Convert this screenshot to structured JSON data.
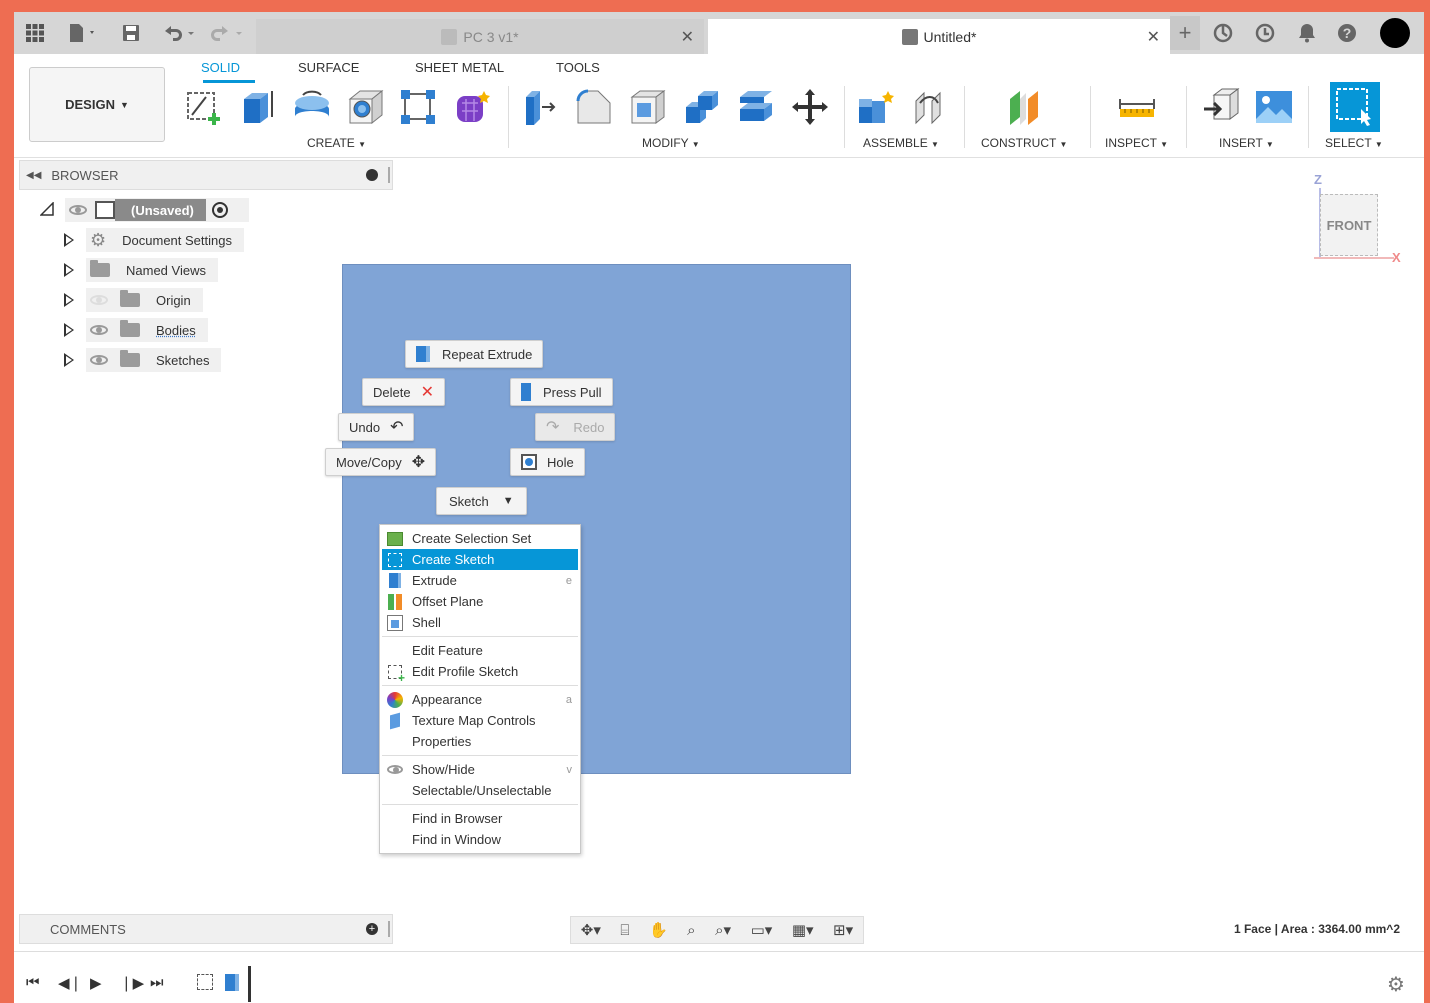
{
  "tabs": {
    "inactive_doc": "PC 3 v1*",
    "active_doc": "Untitled*"
  },
  "toolbar": {
    "design_label": "DESIGN",
    "tabs": [
      "SOLID",
      "SURFACE",
      "SHEET METAL",
      "TOOLS"
    ],
    "groups": {
      "create": "CREATE",
      "modify": "MODIFY",
      "assemble": "ASSEMBLE",
      "construct": "CONSTRUCT",
      "inspect": "INSPECT",
      "insert": "INSERT",
      "select": "SELECT"
    }
  },
  "browser": {
    "title": "BROWSER",
    "root": "(Unsaved)",
    "items": [
      "Document Settings",
      "Named Views",
      "Origin",
      "Bodies",
      "Sketches"
    ]
  },
  "marking_menu": {
    "repeat_extrude": "Repeat Extrude",
    "delete": "Delete",
    "press_pull": "Press Pull",
    "undo": "Undo",
    "redo": "Redo",
    "move_copy": "Move/Copy",
    "hole": "Hole",
    "sketch": "Sketch"
  },
  "context_menu": {
    "items": [
      {
        "label": "Create Selection Set",
        "key": ""
      },
      {
        "label": "Create Sketch",
        "key": ""
      },
      {
        "label": "Extrude",
        "key": "e"
      },
      {
        "label": "Offset Plane",
        "key": ""
      },
      {
        "label": "Shell",
        "key": ""
      },
      {
        "label": "Edit Feature",
        "key": ""
      },
      {
        "label": "Edit Profile Sketch",
        "key": ""
      },
      {
        "label": "Appearance",
        "key": "a"
      },
      {
        "label": "Texture Map Controls",
        "key": ""
      },
      {
        "label": "Properties",
        "key": ""
      },
      {
        "label": "Show/Hide",
        "key": "v"
      },
      {
        "label": "Selectable/Unselectable",
        "key": ""
      },
      {
        "label": "Find in Browser",
        "key": ""
      },
      {
        "label": "Find in Window",
        "key": ""
      }
    ]
  },
  "viewcube": {
    "face": "FRONT",
    "axis_z": "Z",
    "axis_x": "X"
  },
  "comments": {
    "title": "COMMENTS"
  },
  "status": {
    "text": "1 Face | Area : 3364.00 mm^2"
  },
  "colors": {
    "accent": "#0696d7",
    "face": "#80a4d6",
    "window_border": "#ee6d52"
  }
}
